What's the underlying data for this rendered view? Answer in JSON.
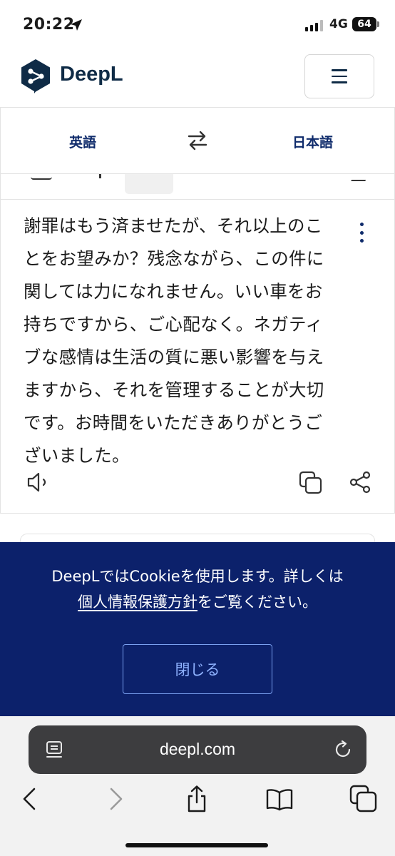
{
  "status_bar": {
    "time": "20:22",
    "network": "4G",
    "battery": "64"
  },
  "header": {
    "brand": "DeepL",
    "icons": {
      "logo": "deepl-logo",
      "menu": "hamburger-icon"
    }
  },
  "languages": {
    "source": "英語",
    "target": "日本語",
    "swap_icon": "swap-arrows-icon"
  },
  "translation": {
    "text": "謝罪はもう済ませたが、それ以上のことをお望みか？残念ながら、この件に関しては力になれません。いい車をお持ちですから、ご心配なく。ネガティブな感情は生活の質に悪い影響を与えますから、それを管理することが大切です。お時間をいただきありがとうございました。",
    "icons": {
      "more": "more-vertical-icon",
      "speak": "speaker-icon",
      "copy": "copy-icon",
      "share": "share-icon"
    }
  },
  "cookie_banner": {
    "text_before": "DeepLではCookieを使用します。詳しくは",
    "link": "個人情報保護方針",
    "text_after": "をご覧ください。",
    "close_label": "閉じる",
    "background": "#0c216b"
  },
  "browser": {
    "url": "deepl.com",
    "icons": {
      "reader": "reader-icon",
      "reload": "reload-icon",
      "back": "back-icon",
      "forward": "forward-icon",
      "share": "share-icon",
      "bookmarks": "bookmarks-icon",
      "tabs": "tabs-icon"
    }
  }
}
